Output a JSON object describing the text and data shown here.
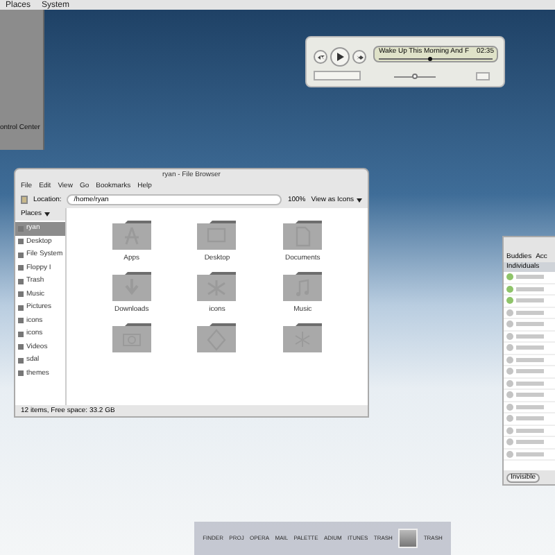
{
  "top_panel": {
    "menus": [
      "Places",
      "System"
    ]
  },
  "side_menu": {
    "item": "ontrol Center"
  },
  "music_player": {
    "track": "Wake Up This Morning And F",
    "time": "02:35",
    "progress": {
      "level": 0.45
    },
    "volume": {
      "level": 0.5
    }
  },
  "file_browser": {
    "title": "ryan - File Browser",
    "menus": [
      "File",
      "Edit",
      "View",
      "Go",
      "Bookmarks",
      "Help"
    ],
    "location_label": "Location:",
    "location": "/home/ryan",
    "zoom": "100%",
    "view_mode": "View as Icons",
    "places_label": "Places",
    "places": [
      {
        "label": "ryan",
        "selected": true
      },
      {
        "label": "Desktop",
        "selected": false
      },
      {
        "label": "File System",
        "selected": false
      },
      {
        "label": "Floppy I",
        "selected": false
      },
      {
        "label": "Trash",
        "selected": false
      },
      {
        "label": "Music",
        "selected": false
      },
      {
        "label": "Pictures",
        "selected": false
      },
      {
        "label": "icons",
        "selected": false
      },
      {
        "label": "icons",
        "selected": false
      },
      {
        "label": "Videos",
        "selected": false
      },
      {
        "label": "sdal",
        "selected": false
      },
      {
        "label": "themes",
        "selected": false
      }
    ],
    "items": [
      {
        "label": "Apps",
        "kind": "apps"
      },
      {
        "label": "Desktop",
        "kind": "desktop"
      },
      {
        "label": "Documents",
        "kind": "document"
      },
      {
        "label": "Downloads",
        "kind": "download"
      },
      {
        "label": "icons",
        "kind": "burst"
      },
      {
        "label": "Music",
        "kind": "music"
      },
      {
        "kind": "camera"
      },
      {
        "kind": "diamond"
      },
      {
        "kind": "star"
      }
    ],
    "status": "12 items, Free space: 33.2 GB"
  },
  "buddy_list": {
    "tabs": [
      "Buddies",
      "Acc"
    ],
    "group": "Individuals",
    "buddies": [
      {
        "online": true
      },
      {
        "online": true
      },
      {
        "online": true
      },
      {
        "online": false
      },
      {
        "online": false
      },
      {
        "online": false
      },
      {
        "online": false
      },
      {
        "online": false
      },
      {
        "online": false
      },
      {
        "online": false
      },
      {
        "online": false
      },
      {
        "online": false
      },
      {
        "online": false
      },
      {
        "online": false
      },
      {
        "online": false
      },
      {
        "online": false
      }
    ],
    "status": "Invisible"
  },
  "dock": {
    "items": [
      {
        "label": "FINDER",
        "kind": "text"
      },
      {
        "label": "PROJ",
        "kind": "text"
      },
      {
        "label": "OPERA",
        "kind": "text"
      },
      {
        "label": "MAIL",
        "kind": "text"
      },
      {
        "label": "PALETTE",
        "kind": "text"
      },
      {
        "label": "ADIUM",
        "kind": "text"
      },
      {
        "label": "ITUNES",
        "kind": "text"
      },
      {
        "label": "TRASH",
        "kind": "text"
      },
      {
        "kind": "tile"
      },
      {
        "label": "TRASH",
        "kind": "text"
      }
    ]
  }
}
